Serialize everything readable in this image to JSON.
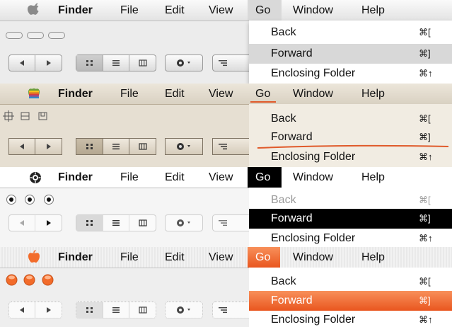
{
  "menubar": {
    "app_name": "Finder",
    "file": "File",
    "edit": "Edit",
    "view": "View",
    "go": "Go",
    "window": "Window",
    "help": "Help"
  },
  "go_menu": {
    "back": {
      "label": "Back",
      "shortcut": "⌘["
    },
    "forward": {
      "label": "Forward",
      "shortcut": "⌘]"
    },
    "enclosing": {
      "label": "Enclosing Folder",
      "shortcut": "⌘↑"
    }
  },
  "themes": [
    {
      "name": "aqua-graphite",
      "menubar_bg": "#f3f3f3",
      "highlight": "#d4d4d4"
    },
    {
      "name": "parchment",
      "menubar_bg": "#e4ddd0",
      "highlight": "#e05a2a"
    },
    {
      "name": "high-contrast",
      "menubar_bg": "#ffffff",
      "highlight": "#000000"
    },
    {
      "name": "aqua-orange",
      "menubar_bg": "#f0f0f0",
      "highlight": "#f26b2a"
    }
  ],
  "icons": {
    "apple": "apple-logo-icon",
    "back": "arrow-left-icon",
    "forward": "arrow-right-icon",
    "icon_view": "grid-view-icon",
    "list_view": "list-view-icon",
    "column_view": "column-view-icon",
    "action": "gear-icon",
    "arrange": "arrange-icon"
  }
}
